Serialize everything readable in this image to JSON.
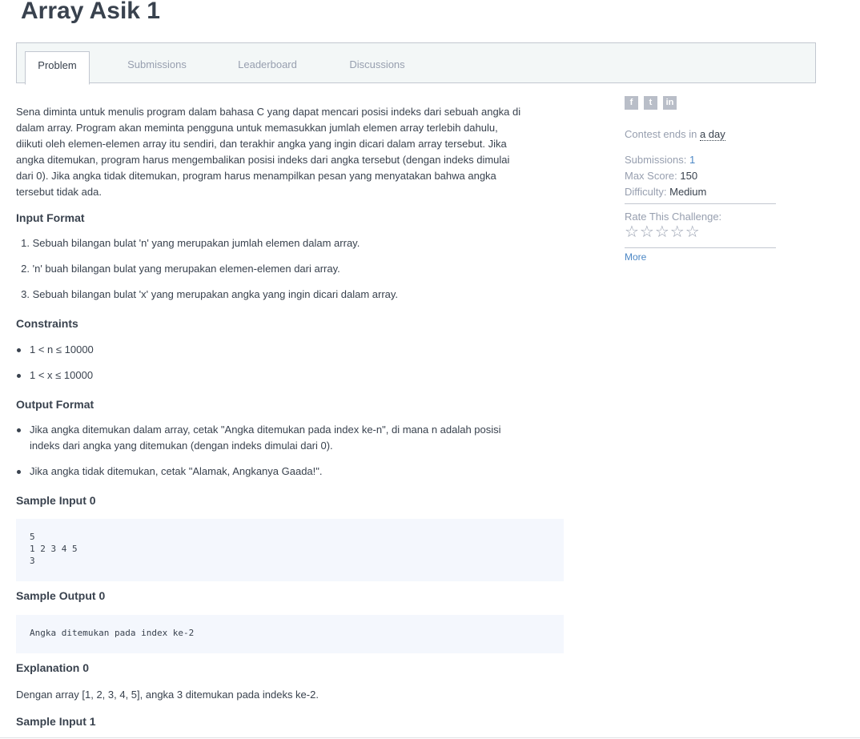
{
  "header": {
    "title": "Array Asik 1"
  },
  "tabs": [
    {
      "label": "Problem",
      "active": true
    },
    {
      "label": "Submissions",
      "active": false
    },
    {
      "label": "Leaderboard",
      "active": false
    },
    {
      "label": "Discussions",
      "active": false
    }
  ],
  "problem": {
    "intro_lines": [
      "Sena diminta untuk menulis program dalam bahasa C yang dapat mencari posisi indeks dari sebuah angka di",
      "dalam array. Program akan meminta pengguna untuk memasukkan jumlah elemen array terlebih dahulu,",
      "diikuti oleh elemen-elemen array itu sendiri, dan terakhir angka yang ingin dicari dalam array tersebut. Jika",
      "angka ditemukan, program harus mengembalikan posisi indeks dari angka tersebut (dengan indeks dimulai",
      "dari 0). Jika angka tidak ditemukan, program harus menampilkan pesan yang menyatakan bahwa angka",
      "tersebut tidak ada."
    ],
    "input_format_heading": "Input Format",
    "input_format_items": [
      {
        "num": "1.",
        "text": "Sebuah bilangan bulat 'n' yang merupakan jumlah elemen dalam array."
      },
      {
        "num": "2.",
        "text": "'n' buah bilangan bulat yang merupakan elemen-elemen dari array."
      },
      {
        "num": "3.",
        "text": "Sebuah bilangan bulat 'x' yang merupakan angka yang ingin dicari dalam array."
      }
    ],
    "constraints_heading": "Constraints",
    "constraints_items": [
      "1 < n ≤ 10000",
      "1 < x ≤ 10000"
    ],
    "output_format_heading": "Output Format",
    "output_format_items": [
      {
        "line1": "Jika angka ditemukan dalam array, cetak \"Angka ditemukan pada index ke-n\", di mana n adalah posisi",
        "line2": "indeks dari angka yang ditemukan (dengan indeks dimulai dari 0)."
      },
      {
        "line1": "Jika angka tidak ditemukan, cetak \"Alamak, Angkanya Gaada!\".",
        "line2": ""
      }
    ],
    "sample_input_0_heading": "Sample Input 0",
    "sample_input_0_lines": [
      "5",
      "1 2 3 4 5",
      "3"
    ],
    "sample_output_0_heading": "Sample Output 0",
    "sample_output_0_lines": [
      "Angka ditemukan pada index ke-2"
    ],
    "explanation_0_heading": "Explanation 0",
    "explanation_0_text": "Dengan array [1, 2, 3, 4, 5], angka 3 ditemukan pada indeks ke-2.",
    "sample_input_1_heading": "Sample Input 1"
  },
  "sidebar": {
    "social": [
      {
        "icon": "facebook-icon",
        "glyph": "f"
      },
      {
        "icon": "twitter-icon",
        "glyph": "t"
      },
      {
        "icon": "linkedin-icon",
        "glyph": "in"
      }
    ],
    "contest_prefix": "Contest ends in",
    "contest_link": "a day",
    "submissions_label": "Submissions:",
    "submissions_value": "1",
    "max_score_label": "Max Score:",
    "max_score_value": "150",
    "difficulty_label": "Difficulty:",
    "difficulty_value": "Medium",
    "rate_label": "Rate This Challenge:",
    "stars": "☆☆☆☆☆",
    "rating_value": 0,
    "more_link": "More"
  },
  "colors": {
    "text": "#39424e",
    "muted": "#979faf",
    "link": "#4c87c5",
    "code_bg": "#f4f7fd",
    "tab_bg": "#f3f7f7"
  }
}
